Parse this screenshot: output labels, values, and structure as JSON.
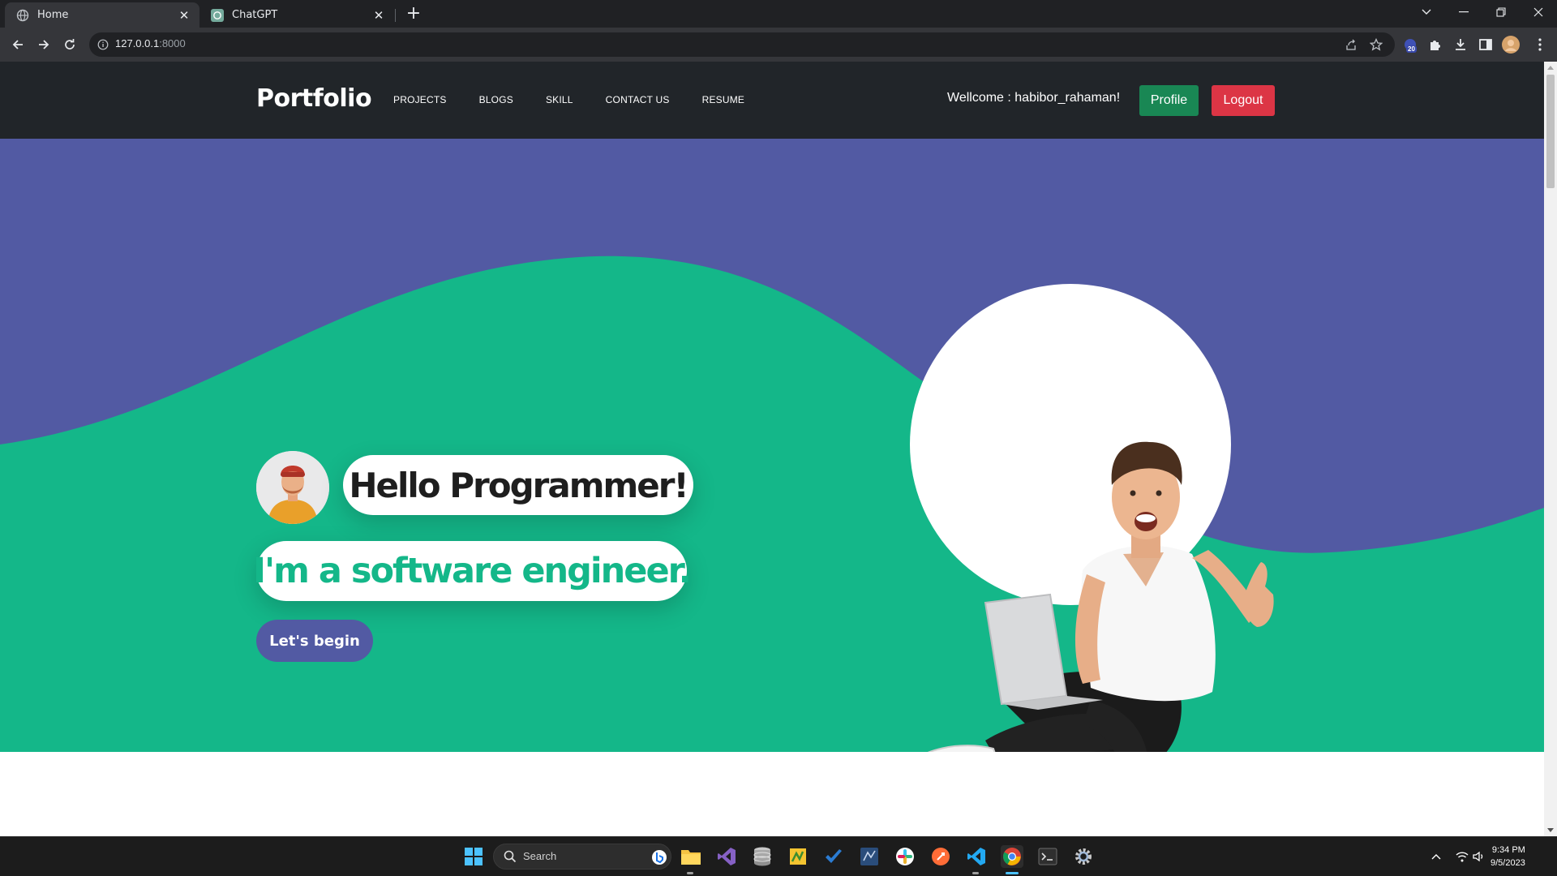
{
  "browser": {
    "tabs": [
      {
        "title": "Home",
        "active": true,
        "icon": "globe-icon"
      },
      {
        "title": "ChatGPT",
        "active": false,
        "icon": "chatgpt-icon"
      }
    ],
    "url": {
      "host": "127.0.0.1",
      "port": ":8000"
    },
    "extension_badge": "20"
  },
  "site": {
    "brand": "Portfolio",
    "nav": [
      "PROJECTS",
      "BLOGS",
      "SKILL",
      "CONTACT US",
      "RESUME"
    ],
    "welcome": "Wellcome : habibor_rahaman!",
    "profile_label": "Profile",
    "logout_label": "Logout"
  },
  "hero": {
    "greeting": "Hello Programmer!",
    "role": "I'm a software engineer.",
    "cta_label": "Let's begin"
  },
  "colors": {
    "nav_bg": "#212529",
    "hero_purple": "#525aa3",
    "hero_green": "#14b789",
    "profile_green": "#198754",
    "logout_red": "#dc3545"
  },
  "taskbar": {
    "search_placeholder": "Search",
    "time": "9:34 PM",
    "date": "9/5/2023",
    "apps": [
      "windows-start-icon",
      "file-explorer-icon",
      "visual-studio-icon",
      "database-icon",
      "sticky-app-icon",
      "todo-icon",
      "ssms-icon",
      "slack-icon",
      "postman-icon",
      "vscode-icon",
      "chrome-icon",
      "terminal-icon",
      "settings-icon"
    ]
  }
}
